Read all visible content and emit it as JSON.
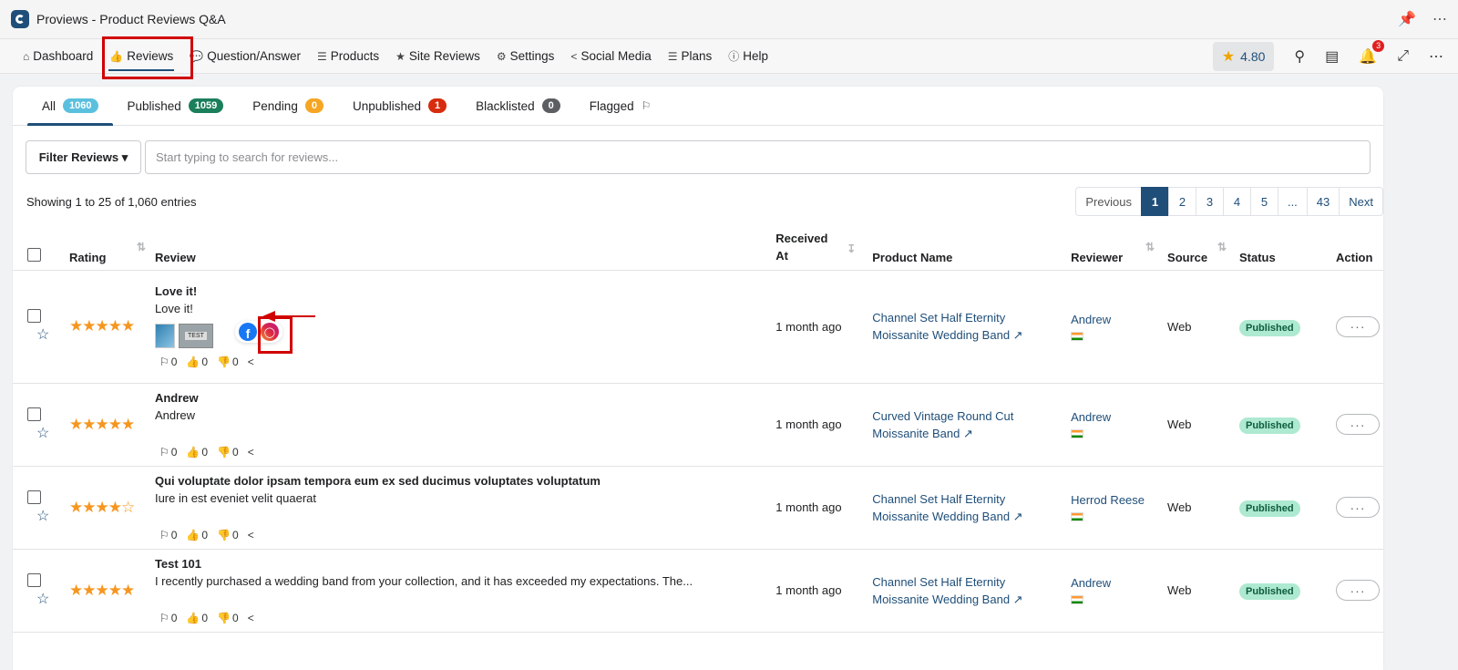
{
  "app": {
    "title": "Proviews - Product Reviews Q&A"
  },
  "nav": {
    "items": [
      {
        "label": "Dashboard",
        "icon": "home-icon"
      },
      {
        "label": "Reviews",
        "icon": "thumbs-up-icon"
      },
      {
        "label": "Question/Answer",
        "icon": "comments-icon"
      },
      {
        "label": "Products",
        "icon": "list-icon"
      },
      {
        "label": "Site Reviews",
        "icon": "star-icon"
      },
      {
        "label": "Settings",
        "icon": "gear-icon"
      },
      {
        "label": "Social Media",
        "icon": "share-icon"
      },
      {
        "label": "Plans",
        "icon": "list-icon"
      },
      {
        "label": "Help",
        "icon": "info-icon"
      }
    ],
    "rating": "4.80",
    "notifications": "3"
  },
  "tabs": [
    {
      "label": "All",
      "count": "1060"
    },
    {
      "label": "Published",
      "count": "1059"
    },
    {
      "label": "Pending",
      "count": "0"
    },
    {
      "label": "Unpublished",
      "count": "1"
    },
    {
      "label": "Blacklisted",
      "count": "0"
    },
    {
      "label": "Flagged"
    }
  ],
  "filter": {
    "button_label": "Filter Reviews",
    "search_placeholder": "Start typing to search for reviews..."
  },
  "entries_text": "Showing 1 to 25 of 1,060 entries",
  "pagination": {
    "prev": "Previous",
    "pages": [
      "1",
      "2",
      "3",
      "4",
      "5",
      "...",
      "43"
    ],
    "next": "Next"
  },
  "columns": {
    "rating": "Rating",
    "review": "Review",
    "received": "Received At",
    "product": "Product Name",
    "reviewer": "Reviewer",
    "source": "Source",
    "status": "Status",
    "action": "Action"
  },
  "rows": [
    {
      "rating": 5,
      "title": "Love it!",
      "body": "Love it!",
      "flags": "0",
      "likes": "0",
      "dislikes": "0",
      "received": "1 month ago",
      "product": "Channel Set Half Eternity Moissanite Wedding Band",
      "reviewer": "Andrew",
      "source": "Web",
      "status": "Published",
      "thumb_label": "TEST"
    },
    {
      "rating": 5,
      "title": "Andrew",
      "body": "Andrew",
      "flags": "0",
      "likes": "0",
      "dislikes": "0",
      "received": "1 month ago",
      "product": "Curved Vintage Round Cut Moissanite Band",
      "reviewer": "Andrew",
      "source": "Web",
      "status": "Published"
    },
    {
      "rating": 4,
      "title": "Qui voluptate dolor ipsam tempora eum ex sed ducimus voluptates voluptatum",
      "body": "Iure in est eveniet velit quaerat",
      "flags": "0",
      "likes": "0",
      "dislikes": "0",
      "received": "1 month ago",
      "product": "Channel Set Half Eternity Moissanite Wedding Band",
      "reviewer": "Herrod Reese",
      "source": "Web",
      "status": "Published"
    },
    {
      "rating": 5,
      "title": "Test 101",
      "body": "I recently purchased a wedding band from your collection, and it has exceeded my expectations. The...",
      "flags": "0",
      "likes": "0",
      "dislikes": "0",
      "received": "1 month ago",
      "product": "Channel Set Half Eternity Moissanite Wedding Band",
      "reviewer": "Andrew",
      "source": "Web",
      "status": "Published"
    }
  ],
  "colors": {
    "primary": "#1f4e79",
    "star": "#f6961f",
    "annotation": "#d10000"
  }
}
